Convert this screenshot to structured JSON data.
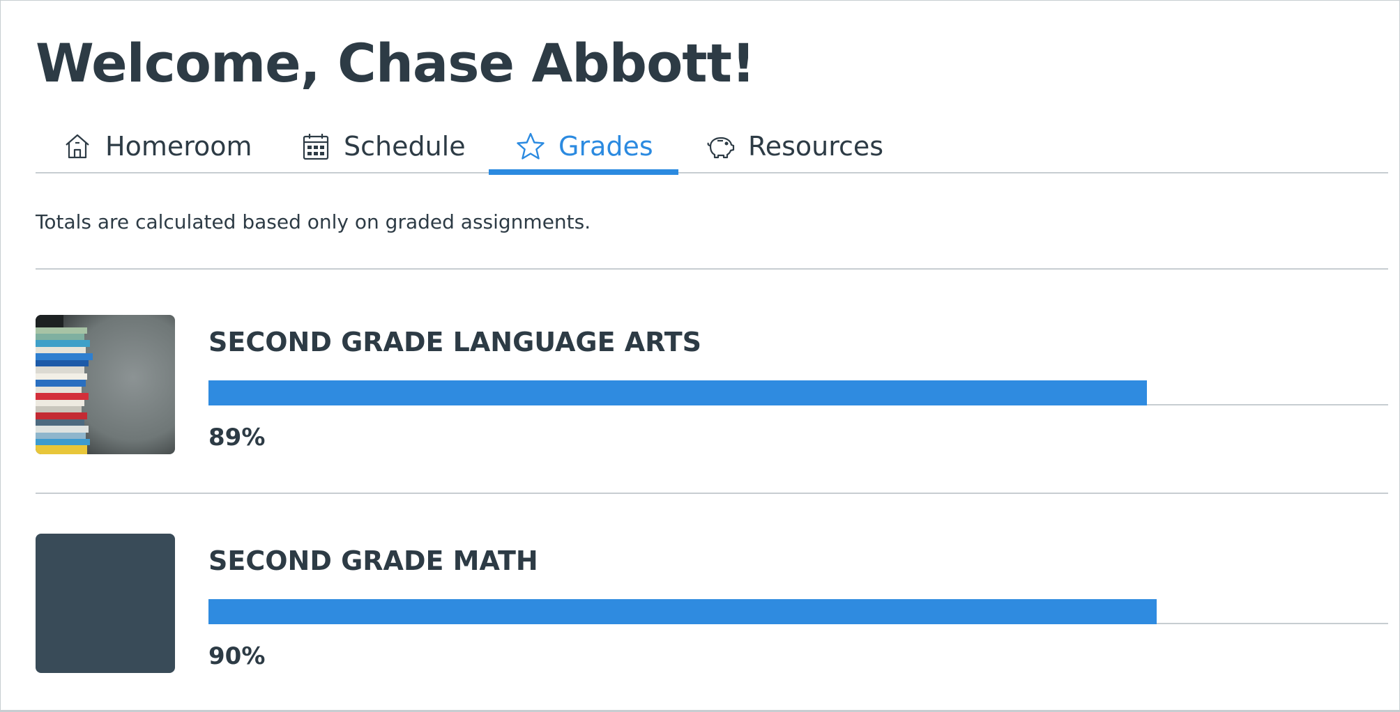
{
  "page": {
    "title": "Welcome, Chase Abbott!",
    "note": "Totals are calculated based only on graded assignments."
  },
  "tabs": [
    {
      "label": "Homeroom",
      "icon": "home-icon",
      "active": false
    },
    {
      "label": "Schedule",
      "icon": "calendar-icon",
      "active": false
    },
    {
      "label": "Grades",
      "icon": "star-icon",
      "active": true
    },
    {
      "label": "Resources",
      "icon": "piggy-bank-icon",
      "active": false
    }
  ],
  "courses": [
    {
      "name": "SECOND GRADE LANGUAGE ARTS",
      "grade_text": "89%",
      "grade_fraction": 0.89,
      "thumbnail": "book-stack-image"
    },
    {
      "name": "SECOND GRADE MATH",
      "grade_text": "90%",
      "grade_fraction": 0.9,
      "thumbnail": "solid-color-tile",
      "thumbnail_color": "#394b58"
    }
  ],
  "colors": {
    "accent": "#2b8ae0",
    "progress": "#2f8be0",
    "text": "#2d3b45",
    "divider": "#c7cdd1"
  }
}
